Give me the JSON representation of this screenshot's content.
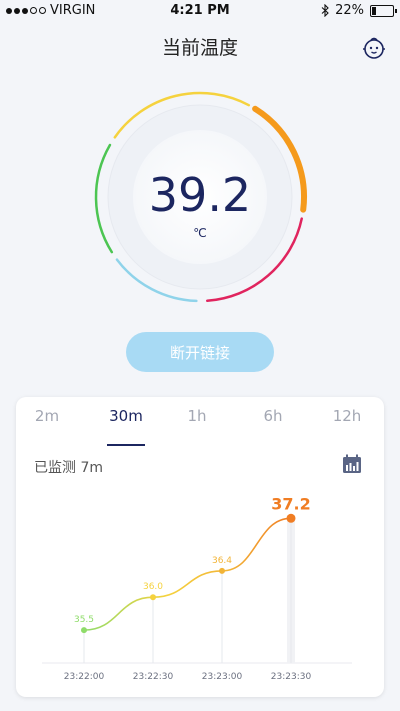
{
  "status_bar": {
    "carrier": "VIRGIN",
    "time": "4:21 PM",
    "battery": "22%",
    "signal_filled": 3,
    "signal_total": 5
  },
  "header": {
    "title": "当前温度",
    "profile_icon": "baby-face-icon"
  },
  "gauge": {
    "reading": "39.2",
    "unit": "℃",
    "segments": [
      {
        "name": "green",
        "color": "#4cc552"
      },
      {
        "name": "yellow",
        "color": "#f5d23e"
      },
      {
        "name": "orange",
        "color": "#f59a1c"
      },
      {
        "name": "red",
        "color": "#e0245e"
      },
      {
        "name": "blue",
        "color": "#8fd3ea"
      }
    ]
  },
  "disconnect_button": {
    "label": "断开链接"
  },
  "history": {
    "tabs": [
      "2m",
      "30m",
      "1h",
      "6h",
      "12h"
    ],
    "active_tab": "30m",
    "monitored_label": "已监测 7m",
    "calendar_icon": "calendar-chart-icon"
  },
  "chart_data": {
    "type": "line",
    "x": [
      "23:22:00",
      "23:22:30",
      "23:23:00",
      "23:23:30"
    ],
    "values": [
      35.5,
      36.0,
      36.4,
      37.2
    ],
    "data_labels": [
      "35.5",
      "36.0",
      "36.4",
      "37.2"
    ],
    "ylim": [
      35.0,
      37.6
    ],
    "colors": [
      "#8fdc6a",
      "#f5d23e",
      "#f2b437",
      "#f07d23"
    ],
    "grid": false
  }
}
